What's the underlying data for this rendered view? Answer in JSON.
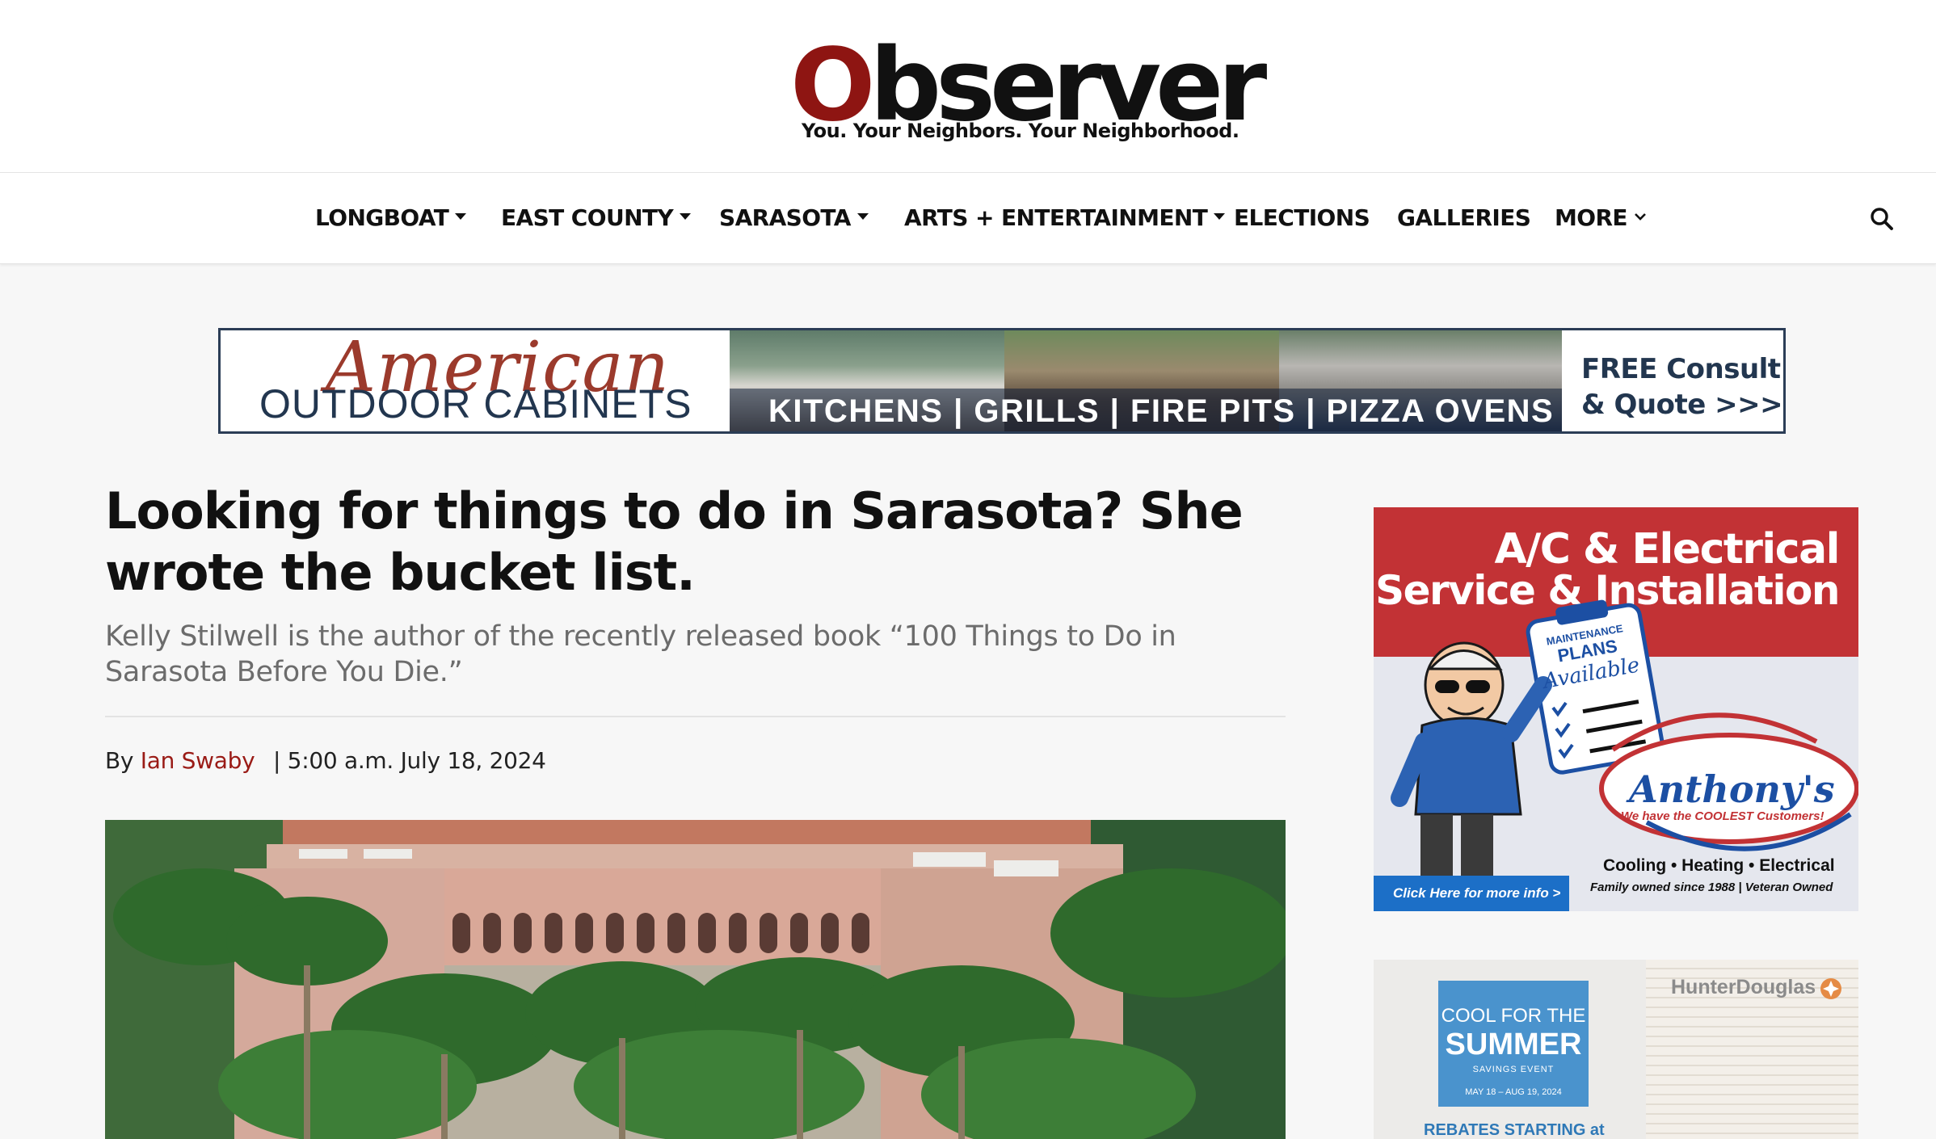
{
  "header": {
    "logo_first_letter": "O",
    "logo_rest": "bserver",
    "tagline": "You. Your Neighbors. Your Neighborhood."
  },
  "nav": {
    "items": [
      {
        "label": "LONGBOAT",
        "dropdown": true
      },
      {
        "label": "EAST COUNTY",
        "dropdown": true
      },
      {
        "label": "SARASOTA",
        "dropdown": true
      },
      {
        "label": "ARTS + ENTERTAINMENT",
        "dropdown": true
      },
      {
        "label": "ELECTIONS",
        "dropdown": false
      },
      {
        "label": "GALLERIES",
        "dropdown": false
      },
      {
        "label": "MORE",
        "dropdown": true
      }
    ],
    "search_icon": "search-icon"
  },
  "banner_ad": {
    "script": "American",
    "brand": "OUTDOOR CABINETS",
    "products": "KITCHENS | GRILLS | FIRE PITS | PIZZA OVENS",
    "cta_line1": "FREE Consult",
    "cta_line2": "& Quote >>>"
  },
  "article": {
    "headline": "Looking for things to do in Sarasota? She wrote the bucket list.",
    "subhead": "Kelly Stilwell is the author of the recently released book “100 Things to Do in Sarasota Before You Die.”",
    "by": "By",
    "author": "Ian Swaby",
    "date": "| 5:00 a.m. July 18, 2024"
  },
  "sidebar_ad1": {
    "line1": "A/C & Electrical",
    "line2": "Service & Installation",
    "clipboard_top": "MAINTENANCE",
    "clipboard_plans": "PLANS",
    "clipboard_available": "Available",
    "brand": "Anthony's",
    "brand_tag": "We have the COOLEST Customers!",
    "services": "Cooling • Heating • Electrical",
    "since": "Family owned since 1988 | Veteran Owned",
    "link": "Click Here for more info >"
  },
  "sidebar_ad2": {
    "line1": "COOL FOR THE",
    "line2": "SUMMER",
    "line3": "SAVINGS EVENT",
    "line4": "MAY 18 – AUG 19, 2024",
    "rebate": "REBATES STARTING at",
    "brand": "HunterDouglas"
  },
  "colors": {
    "brand_red": "#8e1512",
    "author_red": "#9a1b16",
    "ad_red": "#c23235",
    "ad_blue": "#1c6fc7",
    "banner_navy": "#22364f"
  }
}
